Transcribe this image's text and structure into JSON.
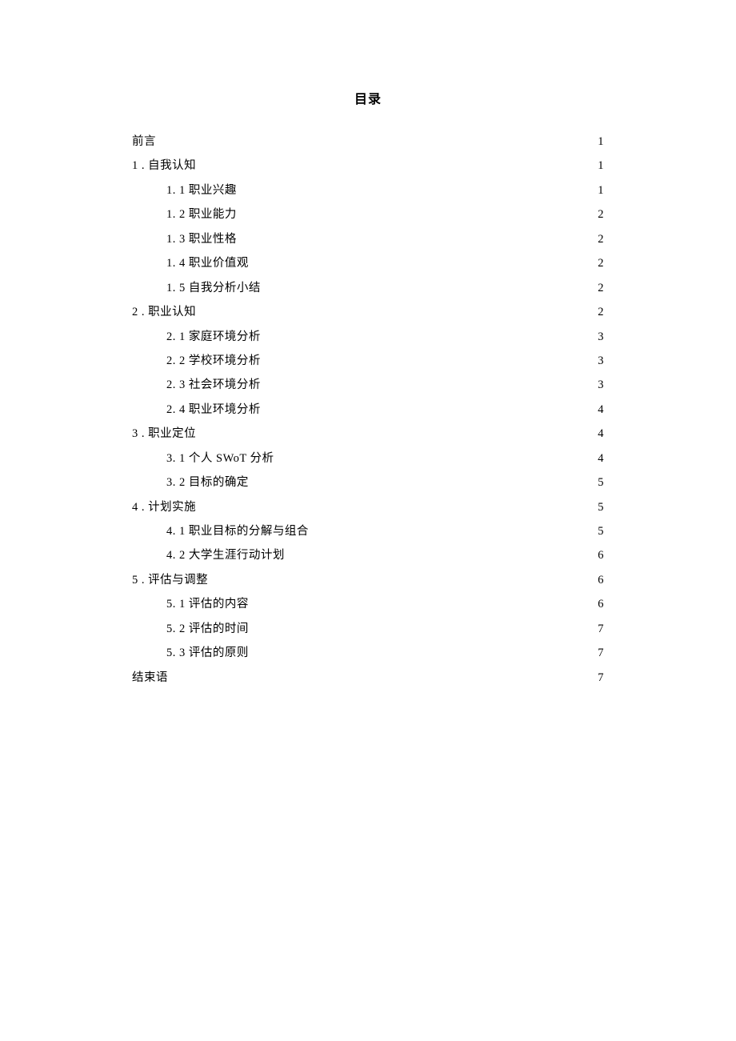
{
  "title": "目录",
  "entries": [
    {
      "level": 0,
      "label": "前言",
      "page": "1"
    },
    {
      "level": 0,
      "label": "1 . 自我认知",
      "page": "1"
    },
    {
      "level": 1,
      "label": "1. 1 职业兴趣",
      "page": "1"
    },
    {
      "level": 1,
      "label": "1. 2 职业能力",
      "page": "2"
    },
    {
      "level": 1,
      "label": "1. 3 职业性格",
      "page": "2"
    },
    {
      "level": 1,
      "label": "1. 4 职业价值观",
      "page": "2"
    },
    {
      "level": 1,
      "label": "1. 5 自我分析小结",
      "page": "2"
    },
    {
      "level": 0,
      "label": "2  . 职业认知",
      "page": "2"
    },
    {
      "level": 1,
      "label": "2. 1 家庭环境分析",
      "page": "3"
    },
    {
      "level": 1,
      "label": "2. 2 学校环境分析",
      "page": "3"
    },
    {
      "level": 1,
      "label": "2. 3 社会环境分析",
      "page": "3"
    },
    {
      "level": 1,
      "label": "2. 4 职业环境分析",
      "page": "4"
    },
    {
      "level": 0,
      "label": "3  . 职业定位",
      "page": "4"
    },
    {
      "level": 1,
      "label": "3. 1 个人 SWoT 分析",
      "page": "4"
    },
    {
      "level": 1,
      "label": "3. 2 目标的确定",
      "page": "5"
    },
    {
      "level": 0,
      "label": "4  . 计划实施",
      "page": "5"
    },
    {
      "level": 1,
      "label": "4. 1 职业目标的分解与组合",
      "page": "5"
    },
    {
      "level": 1,
      "label": "4. 2  大学生涯行动计划",
      "page": "6"
    },
    {
      "level": 0,
      "label": "5  . 评估与调整",
      "page": "6"
    },
    {
      "level": 1,
      "label": "5. 1 评估的内容",
      "page": "6"
    },
    {
      "level": 1,
      "label": "5. 2 评估的时间",
      "page": "7"
    },
    {
      "level": 1,
      "label": "5. 3 评估的原则",
      "page": "7"
    },
    {
      "level": 0,
      "label": "结束语",
      "page": "7"
    }
  ]
}
